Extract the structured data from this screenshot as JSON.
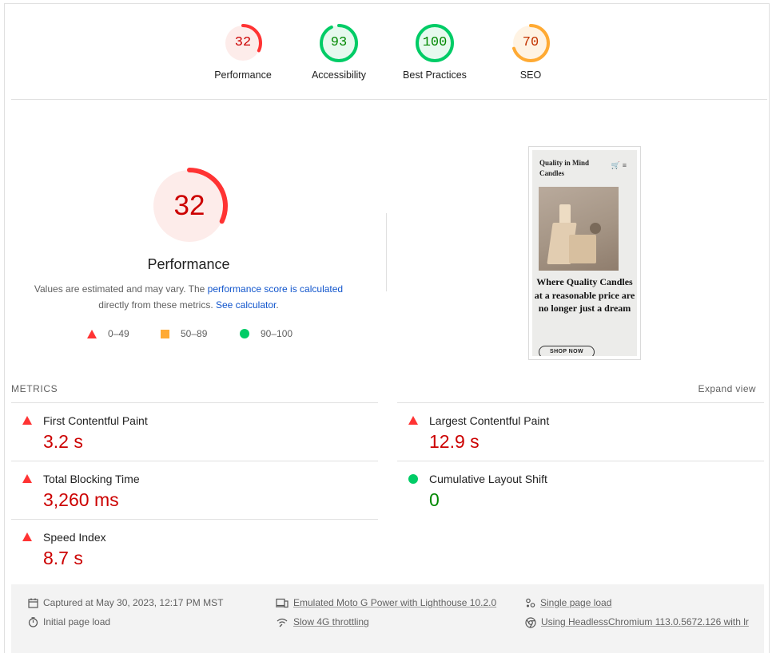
{
  "gauges": [
    {
      "score": "32",
      "label": "Performance",
      "value": 32,
      "color": "#c00",
      "ring": "#f33",
      "fill": "#fdecea"
    },
    {
      "score": "93",
      "label": "Accessibility",
      "value": 93,
      "color": "#080",
      "ring": "#0c6",
      "fill": "#e6f9ee"
    },
    {
      "score": "100",
      "label": "Best Practices",
      "value": 100,
      "color": "#080",
      "ring": "#0c6",
      "fill": "#e6f9ee"
    },
    {
      "score": "70",
      "label": "SEO",
      "value": 70,
      "color": "#c33300",
      "ring": "#fa3",
      "fill": "#fff3e3"
    }
  ],
  "performance": {
    "score": "32",
    "value": 32,
    "title": "Performance",
    "desc_prefix": "Values are estimated and may vary. The ",
    "desc_link1": "performance score is calculated",
    "desc_middle": "directly from these metrics. ",
    "desc_link2": "See calculator",
    "desc_suffix": "."
  },
  "legend": {
    "fail": "0–49",
    "average": "50–89",
    "pass": "90–100"
  },
  "thumbnail": {
    "brand": "Quality in Mind Candles",
    "headline": "Where Quality Candles at a reasonable price are no longer just a dream",
    "button": "SHOP NOW"
  },
  "metrics": {
    "section_label": "METRICS",
    "expand_label": "Expand view",
    "fcp": {
      "title": "First Contentful Paint",
      "value": "3.2 s"
    },
    "lcp": {
      "title": "Largest Contentful Paint",
      "value": "12.9 s"
    },
    "tbt": {
      "title": "Total Blocking Time",
      "value": "3,260 ms"
    },
    "cls": {
      "title": "Cumulative Layout Shift",
      "value": "0"
    },
    "si": {
      "title": "Speed Index",
      "value": "8.7 s"
    }
  },
  "footer": {
    "captured": "Captured at May 30, 2023, 12:17 PM MST",
    "initial": "Initial page load",
    "device": "Emulated Moto G Power with Lighthouse 10.2.0",
    "throttling": "Slow 4G throttling",
    "session": "Single page load",
    "browser": "Using HeadlessChromium 113.0.5672.126 with lr"
  }
}
